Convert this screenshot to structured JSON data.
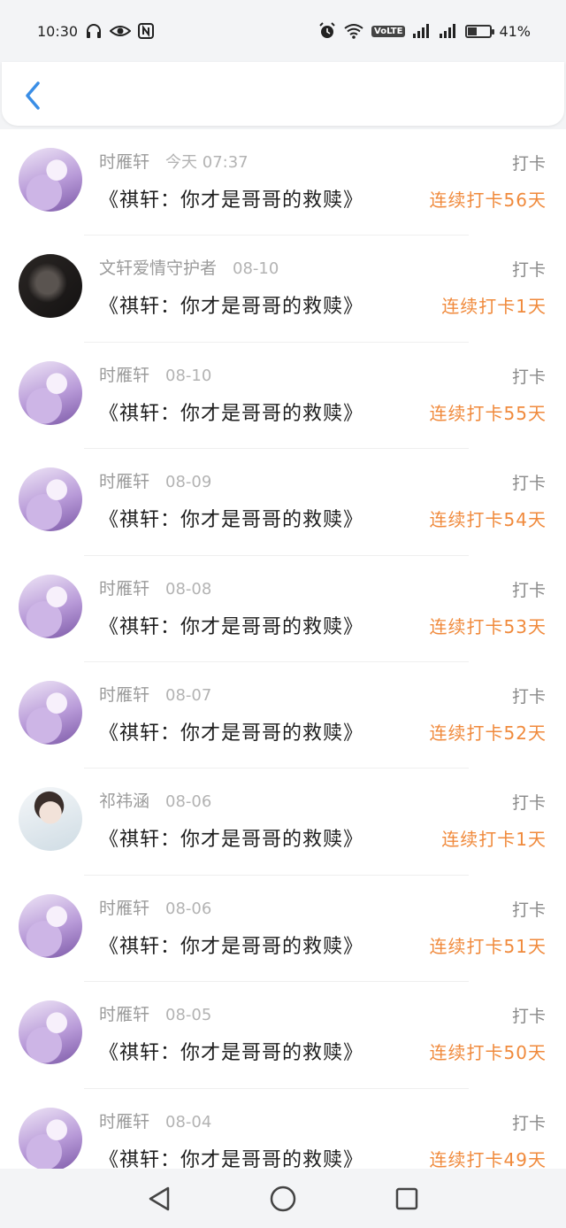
{
  "status_bar": {
    "time": "10:30",
    "battery_text": "41%",
    "battery_level": 0.41,
    "volte": "VoLTE",
    "icons": [
      "headphones-icon",
      "eye-icon",
      "nfc-icon",
      "alarm-icon",
      "wifi-icon",
      "signal-icon",
      "signal-icon-2",
      "battery-icon"
    ]
  },
  "header": {
    "back_icon": "chevron-left-icon",
    "accent": "#3a8ee6"
  },
  "colors": {
    "streak": "#f08a3c",
    "name": "#9b9b9b"
  },
  "rows": [
    {
      "name": "时雁轩",
      "time": "今天 07:37",
      "tag": "打卡",
      "title": "《祺轩：你才是哥哥的救赎》",
      "streak": "连续打卡56天",
      "avatar": "purple"
    },
    {
      "name": "文轩爱情守护者",
      "time": "08-10",
      "tag": "打卡",
      "title": "《祺轩：你才是哥哥的救赎》",
      "streak": "连续打卡1天",
      "avatar": "dark"
    },
    {
      "name": "时雁轩",
      "time": "08-10",
      "tag": "打卡",
      "title": "《祺轩：你才是哥哥的救赎》",
      "streak": "连续打卡55天",
      "avatar": "purple"
    },
    {
      "name": "时雁轩",
      "time": "08-09",
      "tag": "打卡",
      "title": "《祺轩：你才是哥哥的救赎》",
      "streak": "连续打卡54天",
      "avatar": "purple"
    },
    {
      "name": "时雁轩",
      "time": "08-08",
      "tag": "打卡",
      "title": "《祺轩：你才是哥哥的救赎》",
      "streak": "连续打卡53天",
      "avatar": "purple"
    },
    {
      "name": "时雁轩",
      "time": "08-07",
      "tag": "打卡",
      "title": "《祺轩：你才是哥哥的救赎》",
      "streak": "连续打卡52天",
      "avatar": "purple"
    },
    {
      "name": "祁祎涵",
      "time": "08-06",
      "tag": "打卡",
      "title": "《祺轩：你才是哥哥的救赎》",
      "streak": "连续打卡1天",
      "avatar": "light"
    },
    {
      "name": "时雁轩",
      "time": "08-06",
      "tag": "打卡",
      "title": "《祺轩：你才是哥哥的救赎》",
      "streak": "连续打卡51天",
      "avatar": "purple"
    },
    {
      "name": "时雁轩",
      "time": "08-05",
      "tag": "打卡",
      "title": "《祺轩：你才是哥哥的救赎》",
      "streak": "连续打卡50天",
      "avatar": "purple"
    },
    {
      "name": "时雁轩",
      "time": "08-04",
      "tag": "打卡",
      "title": "《祺轩：你才是哥哥的救赎》",
      "streak": "连续打卡49天",
      "avatar": "purple"
    }
  ],
  "nav_bar": {
    "icons": [
      "back-triangle-icon",
      "home-circle-icon",
      "recents-square-icon"
    ]
  }
}
